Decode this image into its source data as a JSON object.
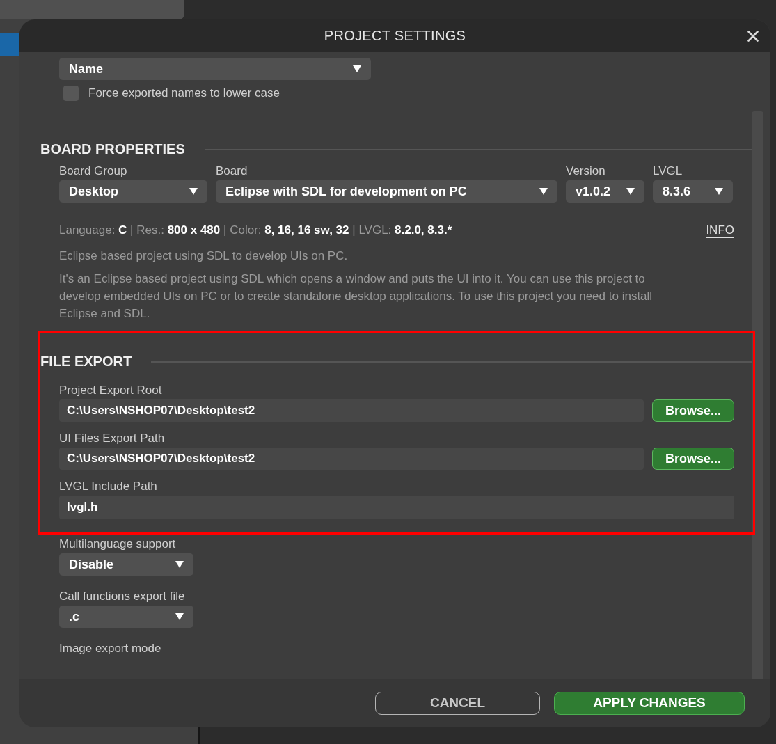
{
  "dialog": {
    "title": "PROJECT SETTINGS"
  },
  "name_select": {
    "value": "Name"
  },
  "lower_case_checkbox": {
    "label": "Force exported names to lower case",
    "checked": false
  },
  "board_properties": {
    "heading": "BOARD PROPERTIES",
    "selects": [
      {
        "label": "Board Group",
        "value": "Desktop"
      },
      {
        "label": "Board",
        "value": "Eclipse with SDL for development on PC"
      },
      {
        "label": "Version",
        "value": "v1.0.2"
      },
      {
        "label": "LVGL",
        "value": "8.3.6"
      }
    ],
    "info_line": [
      {
        "text": "Language: ",
        "bold": false
      },
      {
        "text": "C",
        "bold": true
      },
      {
        "text": " | Res.: ",
        "bold": false
      },
      {
        "text": "800 x 480",
        "bold": true
      },
      {
        "text": " | Color: ",
        "bold": false
      },
      {
        "text": "8, 16, 16 sw, 32",
        "bold": true
      },
      {
        "text": " | LVGL: ",
        "bold": false
      },
      {
        "text": "8.2.0, 8.3.*",
        "bold": true
      }
    ],
    "info_link": "INFO",
    "summary": "Eclipse based project using SDL to develop UIs on PC.",
    "description": "It's an Eclipse based project using SDL which opens a window and puts the UI into it. You can use this project to develop embedded UIs on PC or to create standalone desktop applications. To use this project you need to install Eclipse and SDL."
  },
  "file_export": {
    "heading": "FILE EXPORT",
    "paths": [
      {
        "label": "Project Export Root",
        "value": "C:\\Users\\NSHOP07\\Desktop\\test2",
        "button": "Browse..."
      },
      {
        "label": "UI Files Export Path",
        "value": "C:\\Users\\NSHOP07\\Desktop\\test2",
        "button": "Browse..."
      },
      {
        "label": "LVGL Include Path",
        "value": "lvgl.h"
      }
    ]
  },
  "options": [
    {
      "label": "Multilanguage support",
      "value": "Disable"
    },
    {
      "label": "Call functions export file",
      "value": ".c"
    },
    {
      "label": "Image export mode"
    }
  ],
  "buttons": [
    {
      "label": "CANCEL",
      "kind": "secondary"
    },
    {
      "label": "APPLY CHANGES",
      "kind": "primary"
    }
  ]
}
